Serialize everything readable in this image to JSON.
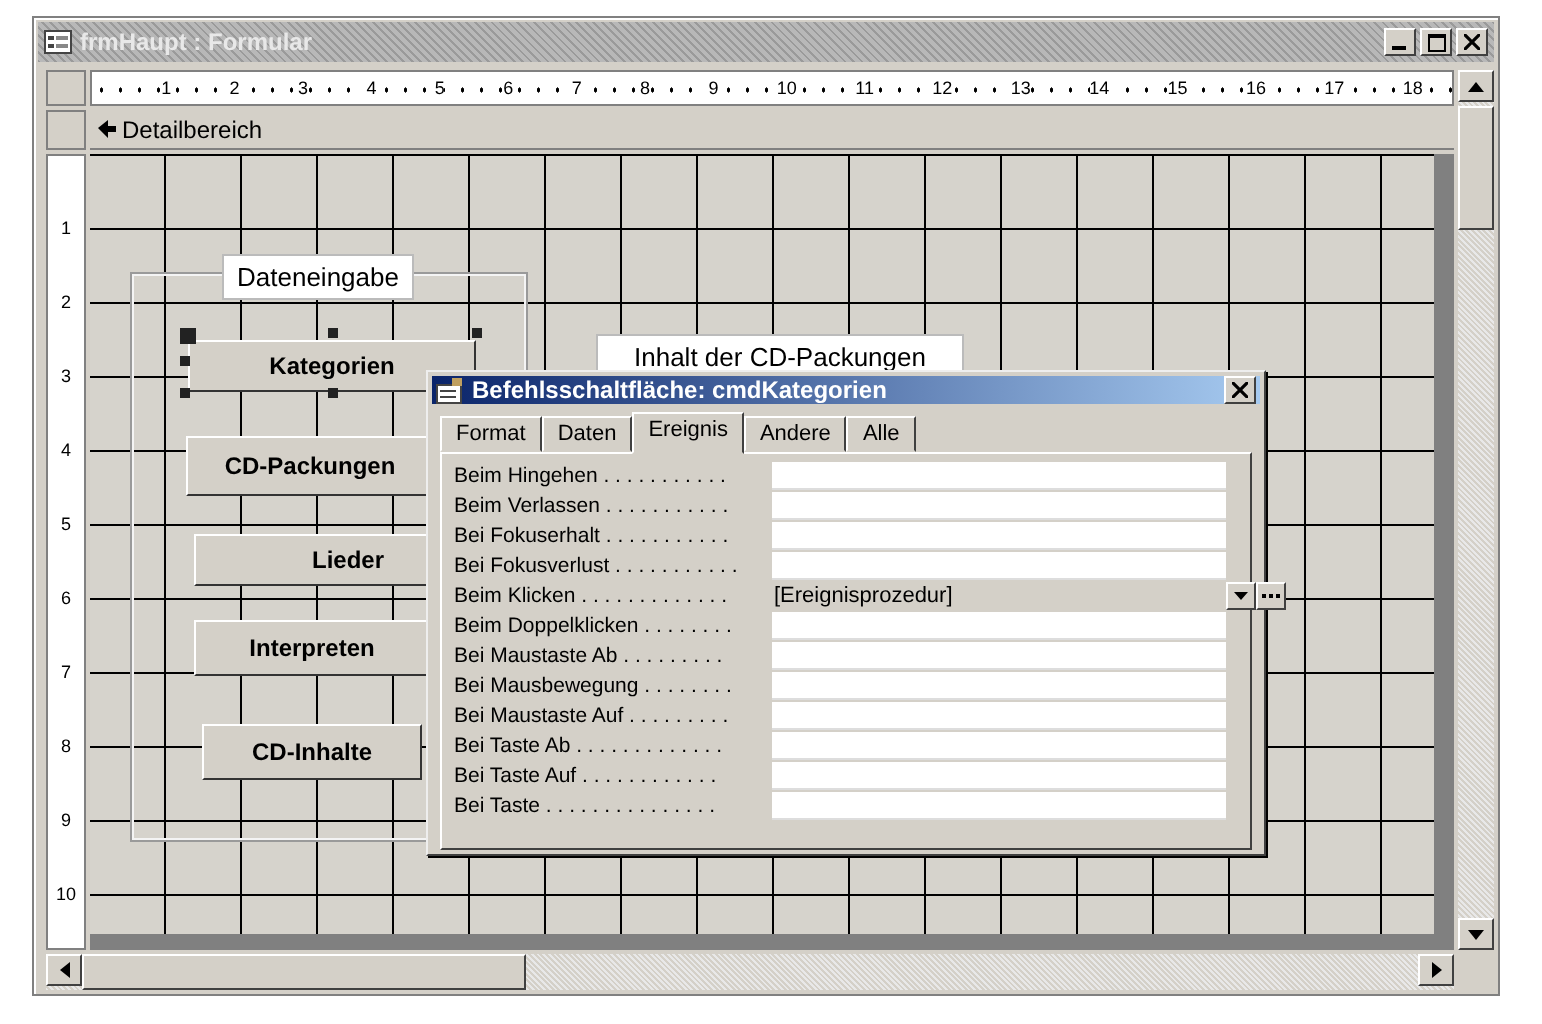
{
  "window": {
    "title": "frmHaupt : Formular"
  },
  "ruler": {
    "horizontal": [
      "1",
      "2",
      "3",
      "4",
      "5",
      "6",
      "7",
      "8",
      "9",
      "10",
      "11",
      "12",
      "13",
      "14",
      "15",
      "16",
      "17",
      "18"
    ],
    "vertical": [
      "1",
      "2",
      "3",
      "4",
      "5",
      "6",
      "7",
      "8",
      "9",
      "10"
    ]
  },
  "section": {
    "label": "Detailbereich"
  },
  "controls": [
    {
      "kind": "frame"
    },
    {
      "kind": "label",
      "text": "Dateneingabe"
    },
    {
      "kind": "button",
      "text": "Kategorien",
      "selected": true
    },
    {
      "kind": "button",
      "text": "CD-Packungen",
      "selected": false
    },
    {
      "kind": "button",
      "text": "Lieder",
      "selected": false
    },
    {
      "kind": "button",
      "text": "Interpreten",
      "selected": false
    },
    {
      "kind": "button",
      "text": "CD-Inhalte",
      "selected": false
    },
    {
      "kind": "label",
      "text": "Inhalt der CD-Packungen"
    }
  ],
  "dialog": {
    "title": "Befehlsschaltfläche: cmdKategorien",
    "tabs": [
      {
        "label": "Format",
        "selected": false
      },
      {
        "label": "Daten",
        "selected": false
      },
      {
        "label": "Ereignis",
        "selected": true
      },
      {
        "label": "Andere",
        "selected": false
      },
      {
        "label": "Alle",
        "selected": false
      }
    ],
    "properties": [
      {
        "name": "Beim Hingehen . . . . . . . . . . .",
        "active": false
      },
      {
        "name": "Beim Verlassen . . . . . . . . . . .",
        "active": false
      },
      {
        "name": "Bei Fokuserhalt . . . . . . . . . . .",
        "active": false
      },
      {
        "name": "Bei Fokusverlust . . . . . . . . . . .",
        "active": false
      },
      {
        "name": "Beim Klicken . . . . . . . . . . . . .",
        "value": "[Ereignisprozedur]",
        "active": true
      },
      {
        "name": "Beim Doppelklicken . . . . . . . .",
        "active": false
      },
      {
        "name": "Bei Maustaste Ab . . . . . . . . .",
        "active": false
      },
      {
        "name": "Bei Mausbewegung . . . . . . . .",
        "active": false
      },
      {
        "name": "Bei Maustaste Auf . . . . . . . . .",
        "active": false
      },
      {
        "name": "Bei Taste Ab . . . . . . . . . . . . .",
        "active": false
      },
      {
        "name": "Bei Taste Auf . . . . . . . . . . . .",
        "active": false
      },
      {
        "name": "Bei Taste . . . . . . . . . . . . . . .",
        "active": false
      }
    ]
  }
}
